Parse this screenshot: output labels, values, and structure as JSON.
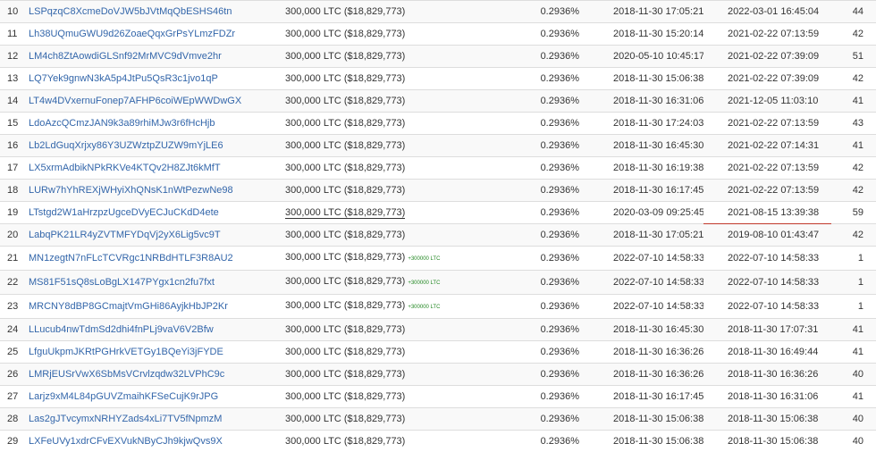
{
  "rows": [
    {
      "rank": "10",
      "address": "LSPqzqC8XcmeDoVJW5bJVtMqQbESHS46tn",
      "balance": "300,000 LTC ($18,829,773)",
      "change": "",
      "percent": "0.2936%",
      "first_in": "2018-11-30 17:05:21",
      "last_in": "2022-03-01 16:45:04",
      "ins": "44"
    },
    {
      "rank": "11",
      "address": "Lh38UQmuGWU9d26ZoaeQqxGrPsYLmzFDZr",
      "balance": "300,000 LTC ($18,829,773)",
      "change": "",
      "percent": "0.2936%",
      "first_in": "2018-11-30 15:20:14",
      "last_in": "2021-02-22 07:13:59",
      "ins": "42"
    },
    {
      "rank": "12",
      "address": "LM4ch8ZtAowdiGLSnf92MrMVC9dVmve2hr",
      "balance": "300,000 LTC ($18,829,773)",
      "change": "",
      "percent": "0.2936%",
      "first_in": "2020-05-10 10:45:17",
      "last_in": "2021-02-22 07:39:09",
      "ins": "51"
    },
    {
      "rank": "13",
      "address": "LQ7Yek9gnwN3kA5p4JtPu5QsR3c1jvo1qP",
      "balance": "300,000 LTC ($18,829,773)",
      "change": "",
      "percent": "0.2936%",
      "first_in": "2018-11-30 15:06:38",
      "last_in": "2021-02-22 07:39:09",
      "ins": "42"
    },
    {
      "rank": "14",
      "address": "LT4w4DVxernuFonep7AFHP6coiWEpWWDwGX",
      "balance": "300,000 LTC ($18,829,773)",
      "change": "",
      "percent": "0.2936%",
      "first_in": "2018-11-30 16:31:06",
      "last_in": "2021-12-05 11:03:10",
      "ins": "41"
    },
    {
      "rank": "15",
      "address": "LdoAzcQCmzJAN9k3a89rhiMJw3r6fHcHjb",
      "balance": "300,000 LTC ($18,829,773)",
      "change": "",
      "percent": "0.2936%",
      "first_in": "2018-11-30 17:24:03",
      "last_in": "2021-02-22 07:13:59",
      "ins": "43"
    },
    {
      "rank": "16",
      "address": "Lb2LdGuqXrjxy86Y3UZWztpZUZW9mYjLE6",
      "balance": "300,000 LTC ($18,829,773)",
      "change": "",
      "percent": "0.2936%",
      "first_in": "2018-11-30 16:45:30",
      "last_in": "2021-02-22 07:14:31",
      "ins": "41"
    },
    {
      "rank": "17",
      "address": "LX5xrmAdbikNPkRKVe4KTQv2H8ZJt6kMfT",
      "balance": "300,000 LTC ($18,829,773)",
      "change": "",
      "percent": "0.2936%",
      "first_in": "2018-11-30 16:19:38",
      "last_in": "2021-02-22 07:13:59",
      "ins": "42"
    },
    {
      "rank": "18",
      "address": "LURw7hYhREXjWHyiXhQNsK1nWtPezwNe98",
      "balance": "300,000 LTC ($18,829,773)",
      "change": "",
      "percent": "0.2936%",
      "first_in": "2018-11-30 16:17:45",
      "last_in": "2021-02-22 07:13:59",
      "ins": "42"
    },
    {
      "rank": "19",
      "address": "LTstgd2W1aHrzpzUgceDVyECJuCKdD4ete",
      "balance": "300,000 LTC ($18,829,773)",
      "change": "",
      "percent": "0.2936%",
      "first_in": "2020-03-09 09:25:45",
      "last_in": "2021-08-15 13:39:38",
      "ins": "59",
      "highlight": true
    },
    {
      "rank": "20",
      "address": "LabqPK21LR4yZVTMFYDqVj2yX6Lig5vc9T",
      "balance": "300,000 LTC ($18,829,773)",
      "change": "",
      "percent": "0.2936%",
      "first_in": "2018-11-30 17:05:21",
      "last_in": "2019-08-10 01:43:47",
      "ins": "42"
    },
    {
      "rank": "21",
      "address": "MN1zegtN7nFLcTCVRgc1NRBdHTLF3R8AU2",
      "balance": "300,000 LTC ($18,829,773)",
      "change": "+300000 LTC",
      "percent": "0.2936%",
      "first_in": "2022-07-10 14:58:33",
      "last_in": "2022-07-10 14:58:33",
      "ins": "1"
    },
    {
      "rank": "22",
      "address": "MS81F51sQ8sLoBgLX147PYgx1cn2fu7fxt",
      "balance": "300,000 LTC ($18,829,773)",
      "change": "+300000 LTC",
      "percent": "0.2936%",
      "first_in": "2022-07-10 14:58:33",
      "last_in": "2022-07-10 14:58:33",
      "ins": "1"
    },
    {
      "rank": "23",
      "address": "MRCNY8dBP8GCmajtVmGHi86AyjkHbJP2Kr",
      "balance": "300,000 LTC ($18,829,773)",
      "change": "+300000 LTC",
      "percent": "0.2936%",
      "first_in": "2022-07-10 14:58:33",
      "last_in": "2022-07-10 14:58:33",
      "ins": "1"
    },
    {
      "rank": "24",
      "address": "LLucub4nwTdmSd2dhi4fnPLj9vaV6V2Bfw",
      "balance": "300,000 LTC ($18,829,773)",
      "change": "",
      "percent": "0.2936%",
      "first_in": "2018-11-30 16:45:30",
      "last_in": "2018-11-30 17:07:31",
      "ins": "41"
    },
    {
      "rank": "25",
      "address": "LfguUkpmJKRtPGHrkVETGy1BQeYi3jFYDE",
      "balance": "300,000 LTC ($18,829,773)",
      "change": "",
      "percent": "0.2936%",
      "first_in": "2018-11-30 16:36:26",
      "last_in": "2018-11-30 16:49:44",
      "ins": "41"
    },
    {
      "rank": "26",
      "address": "LMRjEUSrVwX6SbMsVCrvlzqdw32LVPhC9c",
      "balance": "300,000 LTC ($18,829,773)",
      "change": "",
      "percent": "0.2936%",
      "first_in": "2018-11-30 16:36:26",
      "last_in": "2018-11-30 16:36:26",
      "ins": "40"
    },
    {
      "rank": "27",
      "address": "Larjz9xM4L84pGUVZmaihKFSeCujK9rJPG",
      "balance": "300,000 LTC ($18,829,773)",
      "change": "",
      "percent": "0.2936%",
      "first_in": "2018-11-30 16:17:45",
      "last_in": "2018-11-30 16:31:06",
      "ins": "41"
    },
    {
      "rank": "28",
      "address": "Las2gJTvcymxNRHYZads4xLi7TV5fNpmzM",
      "balance": "300,000 LTC ($18,829,773)",
      "change": "",
      "percent": "0.2936%",
      "first_in": "2018-11-30 15:06:38",
      "last_in": "2018-11-30 15:06:38",
      "ins": "40"
    },
    {
      "rank": "29",
      "address": "LXFeUVy1xdrCFvEXVukNByCJh9kjwQvs9X",
      "balance": "300,000 LTC ($18,829,773)",
      "change": "",
      "percent": "0.2936%",
      "first_in": "2018-11-30 15:06:38",
      "last_in": "2018-11-30 15:06:38",
      "ins": "40"
    }
  ]
}
